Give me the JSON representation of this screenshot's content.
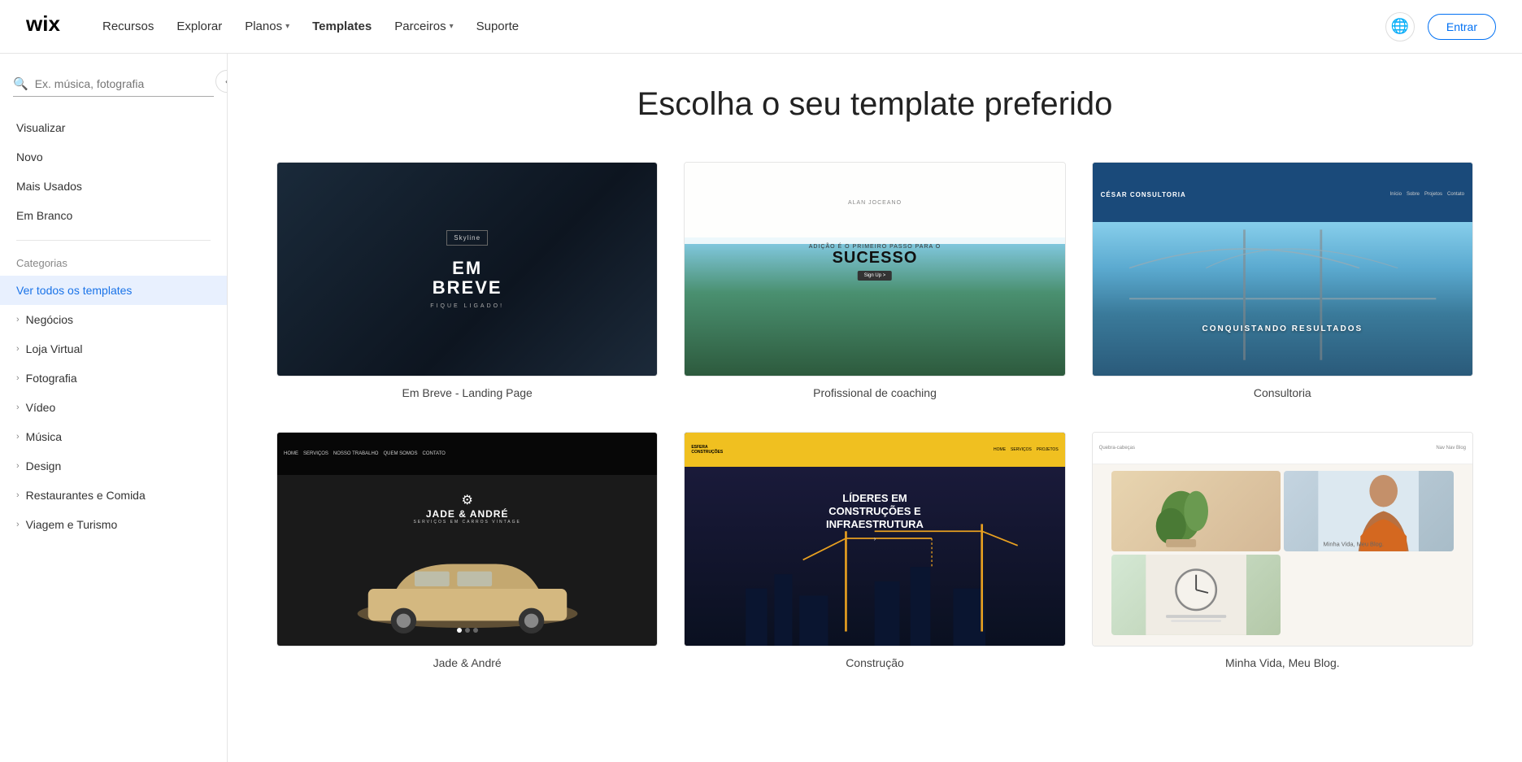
{
  "navbar": {
    "logo_alt": "Wix",
    "nav_items": [
      {
        "id": "recursos",
        "label": "Recursos",
        "has_dropdown": false
      },
      {
        "id": "explorar",
        "label": "Explorar",
        "has_dropdown": false
      },
      {
        "id": "planos",
        "label": "Planos",
        "has_dropdown": true
      },
      {
        "id": "templates",
        "label": "Templates",
        "has_dropdown": false,
        "active": true
      },
      {
        "id": "parceiros",
        "label": "Parceiros",
        "has_dropdown": true
      },
      {
        "id": "suporte",
        "label": "Suporte",
        "has_dropdown": false
      }
    ],
    "entrar_label": "Entrar",
    "globe_icon": "🌐"
  },
  "sidebar": {
    "collapse_icon": "‹",
    "search_placeholder": "Ex. música, fotografia",
    "filters": [
      {
        "id": "visualizar",
        "label": "Visualizar"
      },
      {
        "id": "novo",
        "label": "Novo"
      },
      {
        "id": "mais_usados",
        "label": "Mais Usados"
      },
      {
        "id": "em_branco",
        "label": "Em Branco"
      }
    ],
    "categories_title": "Categorias",
    "categories": [
      {
        "id": "todos",
        "label": "Ver todos os templates",
        "active": true
      },
      {
        "id": "negocios",
        "label": "Negócios"
      },
      {
        "id": "loja_virtual",
        "label": "Loja Virtual"
      },
      {
        "id": "fotografia",
        "label": "Fotografia"
      },
      {
        "id": "video",
        "label": "Vídeo"
      },
      {
        "id": "musica",
        "label": "Música"
      },
      {
        "id": "design",
        "label": "Design"
      },
      {
        "id": "restaurantes",
        "label": "Restaurantes e Comida"
      },
      {
        "id": "viagem",
        "label": "Viagem e Turismo"
      }
    ]
  },
  "content": {
    "title": "Escolha o seu template preferido",
    "templates": [
      {
        "id": "em-breve",
        "name": "Em Breve - Landing Page",
        "style": "dark-construction",
        "text1": "EM",
        "text2": "BREVE",
        "text3": "FIQUE LIGADO!"
      },
      {
        "id": "coaching",
        "name": "Profissional de coaching",
        "style": "coaching-nature",
        "text1": "SUCESSO",
        "text2": "ADIÇÃO É O PRIMEIRO PASSO PARA O"
      },
      {
        "id": "consultoria",
        "name": "Consultoria",
        "style": "consultoria-bridge",
        "text1": "CONQUISTANDO RESULTADOS",
        "text2": "CÉSAR CONSULTORIA"
      },
      {
        "id": "jade-andre",
        "name": "Jade & André",
        "style": "auto-vintage",
        "text1": "JADE & ANDRÉ",
        "text2": "SERVIÇOS EM CARROS VINTAGE"
      },
      {
        "id": "construcao",
        "name": "Construção",
        "style": "construction-dark",
        "text1": "LÍDERES EM",
        "text2": "CONSTRUÇÕES E",
        "text3": "INFRAESTRUTURA"
      },
      {
        "id": "blog",
        "name": "Minha Vida, Meu Blog.",
        "style": "personal-blog",
        "text1": "Minha Vida, Meu Blog."
      }
    ]
  }
}
